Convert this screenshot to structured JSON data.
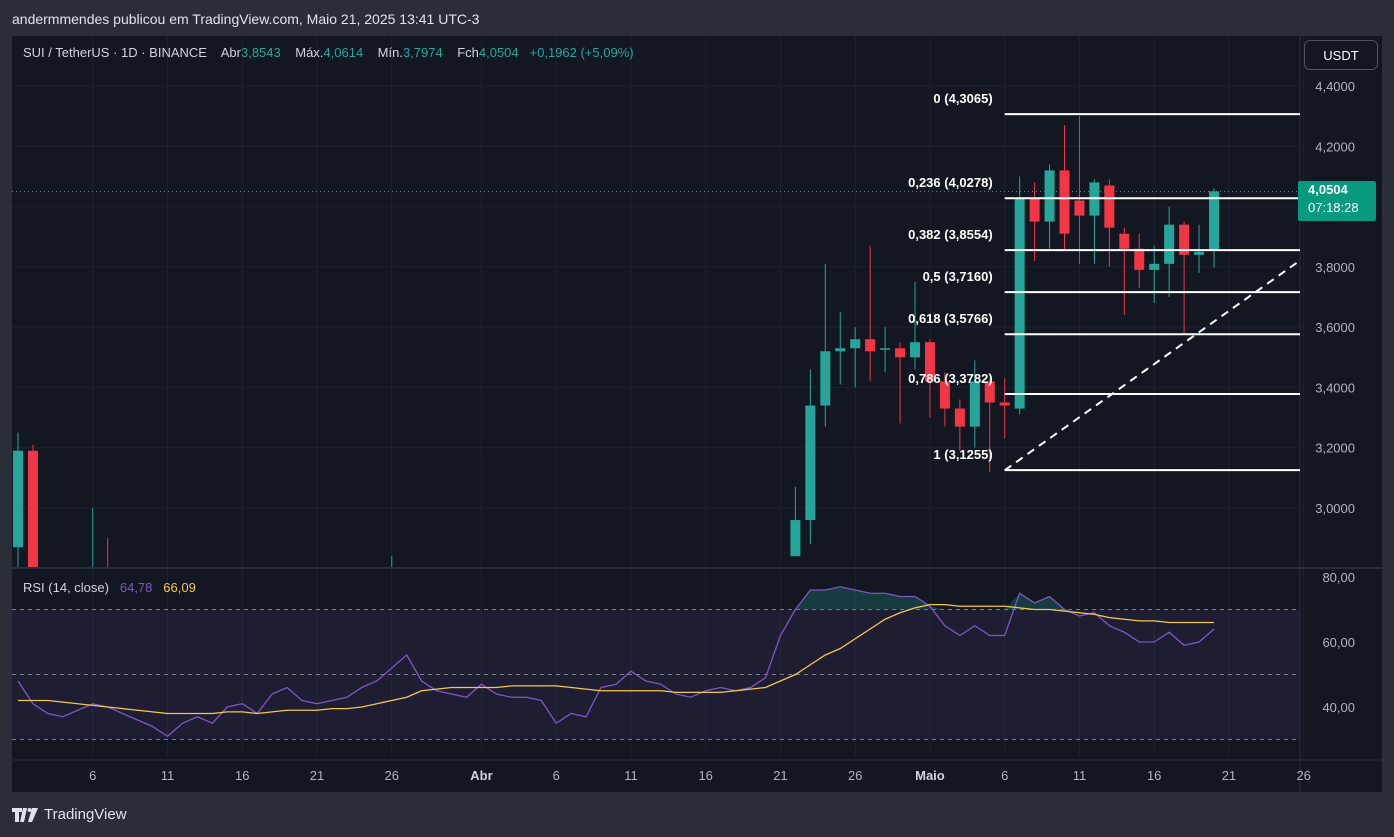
{
  "header": {
    "published_by": "andermmendes publicou em TradingView.com, Maio 21, 2025 13:41 UTC-3"
  },
  "legend": {
    "symbol": "SUI / TetherUS · 1D · BINANCE",
    "open_label": "Abr",
    "open_value": "3,8543",
    "high_label": "Máx.",
    "high_value": "4,0614",
    "low_label": "Mín.",
    "low_value": "3,7974",
    "close_label": "Fch",
    "close_value": "4,0504",
    "change": "+0,1962 (+5,09%)"
  },
  "currency_button": "USDT",
  "price_tag": {
    "price": "4,0504",
    "countdown": "07:18:28"
  },
  "rsi_legend": {
    "label": "RSI (14, close)",
    "rsi_value": "64,78",
    "ma_value": "66,09"
  },
  "footer": {
    "brand": "TradingView"
  },
  "colors": {
    "up": "#26a69a",
    "down": "#f23645",
    "rsi_line": "#7e57c2",
    "rsi_ma": "#f2c94c",
    "background": "#131722"
  },
  "chart_data": {
    "type": "candlestick",
    "symbol": "SUI/USDT",
    "interval": "1D",
    "price_axis": {
      "ylim": [
        2.85,
        4.45
      ],
      "ticks": [
        "4,4000",
        "4,2000",
        "4,0000",
        "3,8000",
        "3,6000",
        "3,4000",
        "3,2000",
        "3,0000"
      ],
      "tick_values": [
        4.4,
        4.2,
        4.0,
        3.8,
        3.6,
        3.4,
        3.2,
        3.0
      ]
    },
    "x_axis": {
      "ticks": [
        "6",
        "11",
        "16",
        "21",
        "26",
        "Abr",
        "6",
        "11",
        "16",
        "21",
        "26",
        "Maio",
        "6",
        "11",
        "16",
        "21",
        "26"
      ],
      "tick_index": [
        5,
        10,
        15,
        20,
        25,
        31,
        36,
        41,
        46,
        51,
        56,
        61,
        66,
        71,
        76,
        81,
        86
      ]
    },
    "candles": [
      {
        "i": 0,
        "o": 2.87,
        "h": 3.25,
        "l": 2.6,
        "c": 3.19
      },
      {
        "i": 1,
        "o": 3.19,
        "h": 3.21,
        "l": 2.6,
        "c": 2.8
      },
      {
        "i": 5,
        "o": 2.72,
        "h": 3.0,
        "l": 2.6,
        "c": 2.75
      },
      {
        "i": 6,
        "o": 2.75,
        "h": 2.9,
        "l": 2.6,
        "c": 2.65
      },
      {
        "i": 25,
        "o": 2.72,
        "h": 2.84,
        "l": 2.6,
        "c": 2.76
      },
      {
        "i": 52,
        "o": 2.84,
        "h": 3.07,
        "l": 2.84,
        "c": 2.96
      },
      {
        "i": 53,
        "o": 2.96,
        "h": 3.46,
        "l": 2.88,
        "c": 3.34
      },
      {
        "i": 54,
        "o": 3.34,
        "h": 3.81,
        "l": 3.27,
        "c": 3.52
      },
      {
        "i": 55,
        "o": 3.52,
        "h": 3.65,
        "l": 3.41,
        "c": 3.53
      },
      {
        "i": 56,
        "o": 3.53,
        "h": 3.6,
        "l": 3.4,
        "c": 3.56
      },
      {
        "i": 57,
        "o": 3.56,
        "h": 3.87,
        "l": 3.42,
        "c": 3.52
      },
      {
        "i": 58,
        "o": 3.53,
        "h": 3.6,
        "l": 3.45,
        "c": 3.53
      },
      {
        "i": 59,
        "o": 3.53,
        "h": 3.55,
        "l": 3.28,
        "c": 3.5
      },
      {
        "i": 60,
        "o": 3.5,
        "h": 3.75,
        "l": 3.46,
        "c": 3.55
      },
      {
        "i": 61,
        "o": 3.55,
        "h": 3.56,
        "l": 3.3,
        "c": 3.42
      },
      {
        "i": 62,
        "o": 3.42,
        "h": 3.45,
        "l": 3.27,
        "c": 3.33
      },
      {
        "i": 63,
        "o": 3.33,
        "h": 3.36,
        "l": 3.19,
        "c": 3.27
      },
      {
        "i": 64,
        "o": 3.27,
        "h": 3.49,
        "l": 3.2,
        "c": 3.42
      },
      {
        "i": 65,
        "o": 3.42,
        "h": 3.43,
        "l": 3.12,
        "c": 3.35
      },
      {
        "i": 66,
        "o": 3.35,
        "h": 3.43,
        "l": 3.23,
        "c": 3.34
      },
      {
        "i": 67,
        "o": 3.33,
        "h": 4.1,
        "l": 3.31,
        "c": 4.03
      },
      {
        "i": 68,
        "o": 4.03,
        "h": 4.08,
        "l": 3.82,
        "c": 3.95
      },
      {
        "i": 69,
        "o": 3.95,
        "h": 4.14,
        "l": 3.86,
        "c": 4.12
      },
      {
        "i": 70,
        "o": 4.12,
        "h": 4.27,
        "l": 3.86,
        "c": 3.91
      },
      {
        "i": 71,
        "o": 4.02,
        "h": 4.3,
        "l": 3.81,
        "c": 3.97
      },
      {
        "i": 72,
        "o": 3.97,
        "h": 4.09,
        "l": 3.81,
        "c": 4.08
      },
      {
        "i": 73,
        "o": 4.07,
        "h": 4.09,
        "l": 3.8,
        "c": 3.93
      },
      {
        "i": 74,
        "o": 3.91,
        "h": 3.93,
        "l": 3.64,
        "c": 3.86
      },
      {
        "i": 75,
        "o": 3.86,
        "h": 3.91,
        "l": 3.73,
        "c": 3.79
      },
      {
        "i": 76,
        "o": 3.79,
        "h": 3.87,
        "l": 3.68,
        "c": 3.81
      },
      {
        "i": 77,
        "o": 3.81,
        "h": 4.0,
        "l": 3.7,
        "c": 3.94
      },
      {
        "i": 78,
        "o": 3.94,
        "h": 3.95,
        "l": 3.58,
        "c": 3.84
      },
      {
        "i": 79,
        "o": 3.84,
        "h": 3.94,
        "l": 3.78,
        "c": 3.85
      },
      {
        "i": 80,
        "o": 3.8543,
        "h": 4.0614,
        "l": 3.7974,
        "c": 4.0504
      }
    ],
    "fibonacci": {
      "levels": [
        {
          "ratio": "0",
          "value": "4,3065",
          "price": 4.3065
        },
        {
          "ratio": "0,236",
          "value": "4,0278",
          "price": 4.0278
        },
        {
          "ratio": "0,382",
          "value": "3,8554",
          "price": 3.8554
        },
        {
          "ratio": "0,5",
          "value": "3,7160",
          "price": 3.716
        },
        {
          "ratio": "0,618",
          "value": "3,5766",
          "price": 3.5766
        },
        {
          "ratio": "0,786",
          "value": "3,3782",
          "price": 3.3782
        },
        {
          "ratio": "1",
          "value": "3,1255",
          "price": 3.1255
        }
      ],
      "from_index": 66,
      "to_index": 86
    },
    "trendline": {
      "from": {
        "i": 66,
        "price": 3.125
      },
      "to": {
        "i": 86,
        "price": 3.83
      },
      "style": "dashed"
    },
    "last_price": 4.0504,
    "rsi": {
      "label": "RSI (14, close)",
      "ylim": [
        27,
        82
      ],
      "ticks": [
        "80,00",
        "60,00",
        "40,00"
      ],
      "tick_values": [
        80,
        60,
        40
      ],
      "band_upper": 70,
      "band_mid": 50,
      "band_lower": 30,
      "rsi_values": [
        48,
        41,
        38,
        37,
        39,
        41,
        40,
        38,
        36,
        34,
        31,
        35,
        37,
        35,
        40,
        41,
        38,
        44,
        46,
        42,
        41,
        42,
        43,
        46,
        48,
        52,
        56,
        48,
        45,
        44,
        43,
        47,
        44,
        43,
        43,
        42,
        35,
        38,
        37,
        46,
        47,
        51,
        48,
        47,
        44,
        43,
        45,
        46,
        45,
        46,
        49,
        62,
        70,
        76,
        76,
        77,
        76,
        75,
        75,
        74,
        74,
        71,
        65,
        62,
        65,
        62,
        62,
        75,
        72,
        74,
        70,
        68,
        69,
        65,
        63,
        60,
        60,
        63,
        59,
        60,
        64
      ],
      "ma_values": [
        42,
        42,
        42,
        41.5,
        41,
        40.5,
        40,
        39.5,
        39,
        38.5,
        38,
        38,
        38,
        38,
        38.5,
        38.5,
        38,
        38.5,
        39,
        39,
        39,
        39.5,
        39.5,
        40,
        41,
        42,
        43,
        45,
        45.5,
        46,
        46,
        46,
        46,
        46.5,
        46.5,
        46.5,
        46.5,
        46,
        45.5,
        45,
        45,
        45,
        45,
        45,
        44.5,
        44.5,
        44.5,
        44.5,
        45,
        45.5,
        46,
        48,
        50,
        53,
        56,
        58,
        61,
        64,
        67,
        69,
        70.5,
        71.5,
        71.5,
        71,
        71,
        71,
        71,
        70.5,
        70,
        70,
        69.5,
        69,
        68.5,
        67.5,
        67,
        66.5,
        66.5,
        66,
        66,
        66,
        66
      ]
    }
  }
}
